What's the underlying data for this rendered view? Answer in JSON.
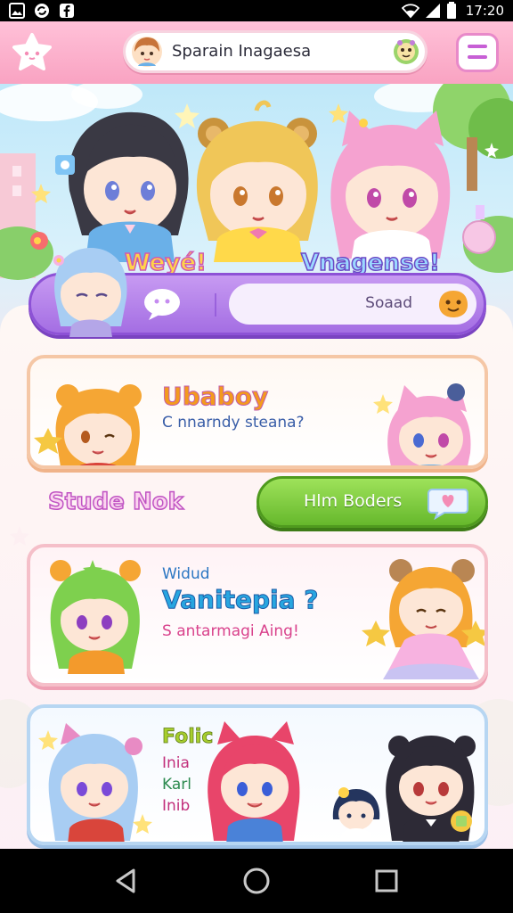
{
  "status_bar": {
    "time": "17:20",
    "icons": [
      "image-icon",
      "sync-icon",
      "facebook-icon",
      "wifi-icon",
      "signal-icon",
      "battery-icon"
    ]
  },
  "app_bar": {
    "menu_icon": "star-cat-icon",
    "search_text": "Sparain Inagaesa",
    "search_badge_icon": "monster-badge-icon",
    "hamburger_icon": "hamburger-icon"
  },
  "hero": {
    "brand_left": "Weyé!",
    "brand_right": "Vnagense!",
    "field_label": "Soaad"
  },
  "cards": [
    {
      "title": "Ubaboy",
      "subtitle": "C nnarndy steana?"
    },
    {
      "line1": "Widud",
      "title": "Vanitepia ?",
      "subtitle": "S antarmagi Aing!"
    },
    {
      "title": "Folic",
      "lines": [
        "Inia",
        "Karl",
        "Inib"
      ]
    }
  ],
  "section": {
    "label": "Stude Nok",
    "button_label": "Hlm Boders"
  },
  "colors": {
    "app_bar_pink": "#f9a3c2",
    "purple_bar": "#a46ee3",
    "green_button": "#66b82c",
    "panel_bg": "#fff8f4"
  },
  "nav_bar": {
    "back_icon": "back-triangle-icon",
    "home_icon": "home-circle-icon",
    "recents_icon": "recents-square-icon"
  }
}
